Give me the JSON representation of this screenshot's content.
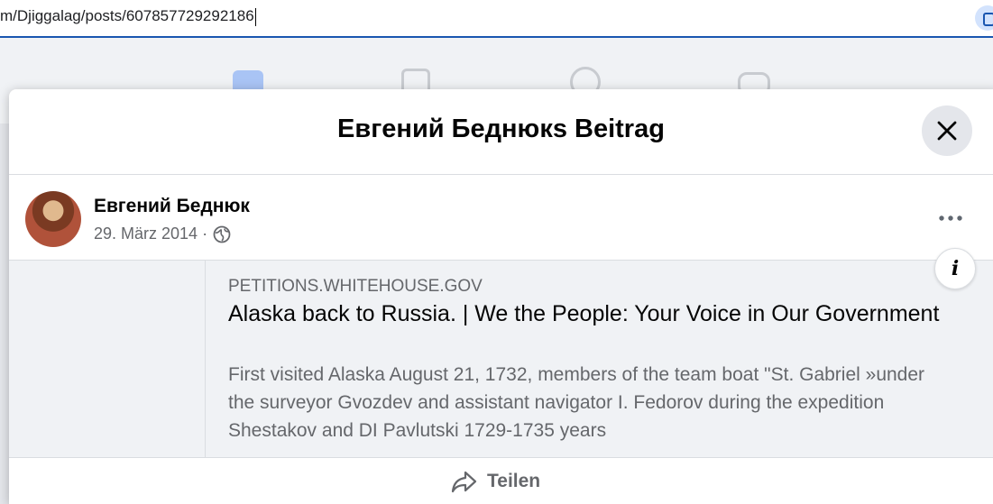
{
  "browser": {
    "url_text": "m/Djiggalag/posts/607857729292186"
  },
  "modal": {
    "title": "Евгений Беднюкs Beitrag",
    "close_icon": "close-icon"
  },
  "post": {
    "author": "Евгений Беднюк",
    "date": "29. März 2014",
    "separator": "·",
    "audience_icon": "globe-icon",
    "more_icon": "more-icon",
    "info_icon": "info-icon"
  },
  "link_preview": {
    "domain": "PETITIONS.WHITEHOUSE.GOV",
    "title": "Alaska back to Russia. | We the People: Your Voice in Our Government",
    "description": "First visited Alaska August 21, 1732, members of the team boat \"St. Gabriel »under the surveyor Gvozdev and assistant navigator I. Fedorov during the expedition Shestakov and DI Pavlutski 1729-1735 years"
  },
  "actions": {
    "share_label": "Teilen"
  },
  "colors": {
    "accent": "#1a56b0",
    "text_primary": "#050505",
    "text_secondary": "#65676b",
    "card_bg": "#f0f2f5"
  }
}
